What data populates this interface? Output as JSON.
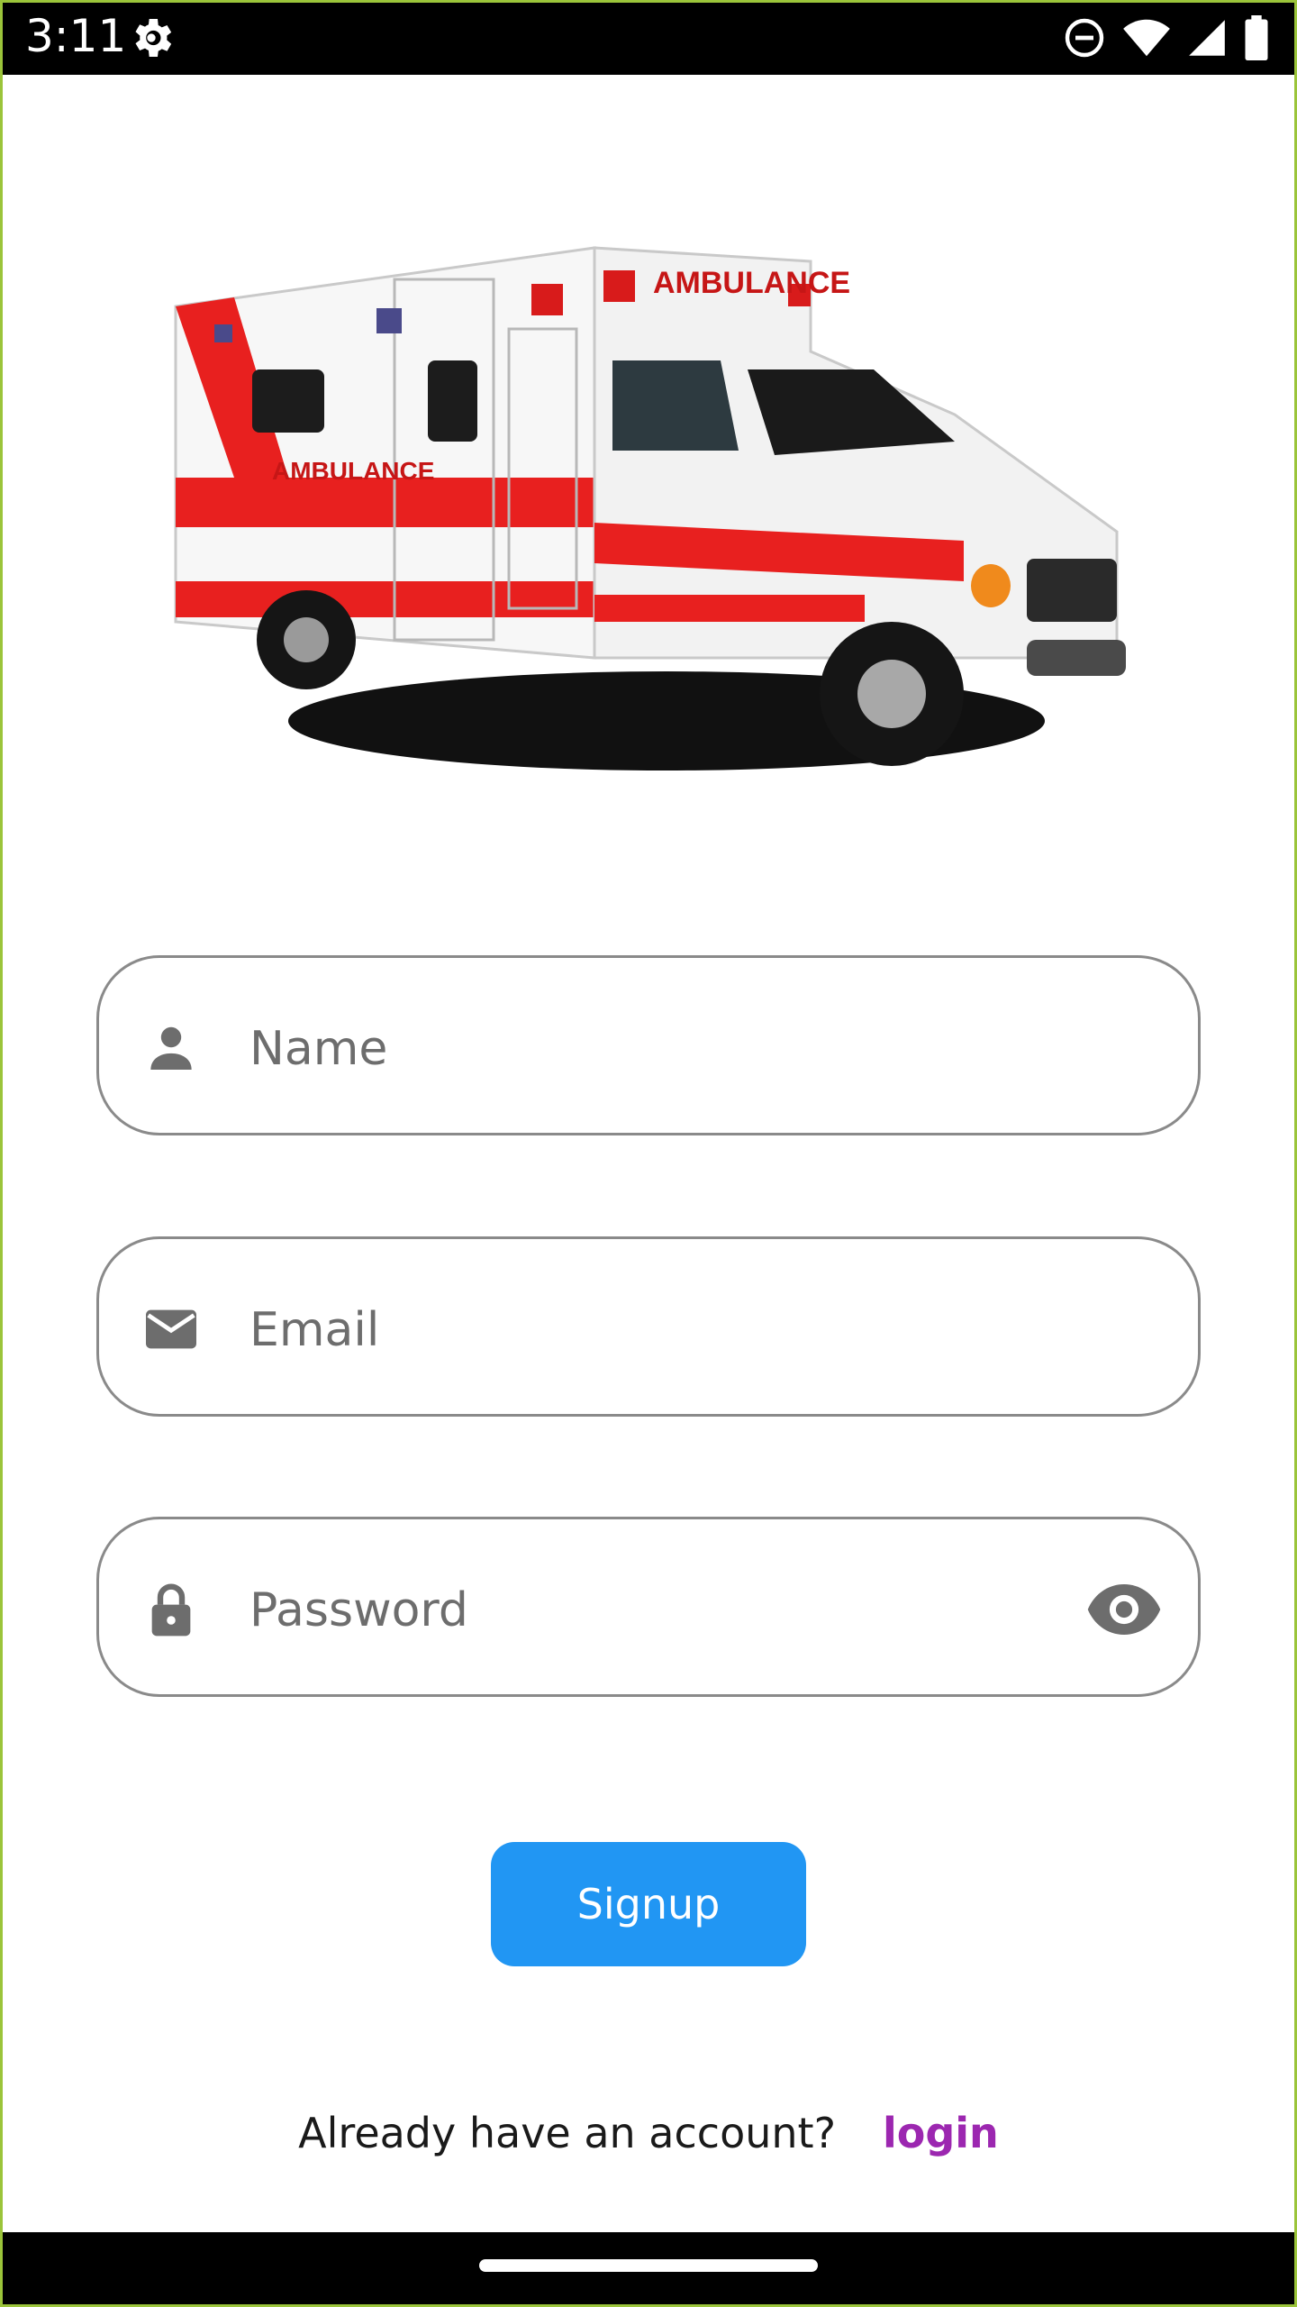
{
  "status_bar": {
    "time": "3:11",
    "icons": [
      "settings-gear-icon",
      "do-not-disturb-icon",
      "wifi-icon",
      "signal-icon",
      "battery-icon"
    ]
  },
  "hero": {
    "image": "ambulance-illustration",
    "vehicle_text": "AMBULANCE"
  },
  "form": {
    "name": {
      "placeholder": "Name",
      "value": "",
      "icon": "person-icon"
    },
    "email": {
      "placeholder": "Email",
      "value": "",
      "icon": "mail-icon"
    },
    "password": {
      "placeholder": "Password",
      "value": "",
      "icon": "lock-icon",
      "toggle_icon": "eye-icon"
    }
  },
  "signup_label": "Signup",
  "footer": {
    "prompt": "Already have an account?",
    "login_label": "login"
  },
  "colors": {
    "primary": "#2196f3",
    "link": "#9c27b0",
    "field_border": "#8a8a8a",
    "icon": "#6d6d6d",
    "ambulance_red": "#e8201f"
  }
}
